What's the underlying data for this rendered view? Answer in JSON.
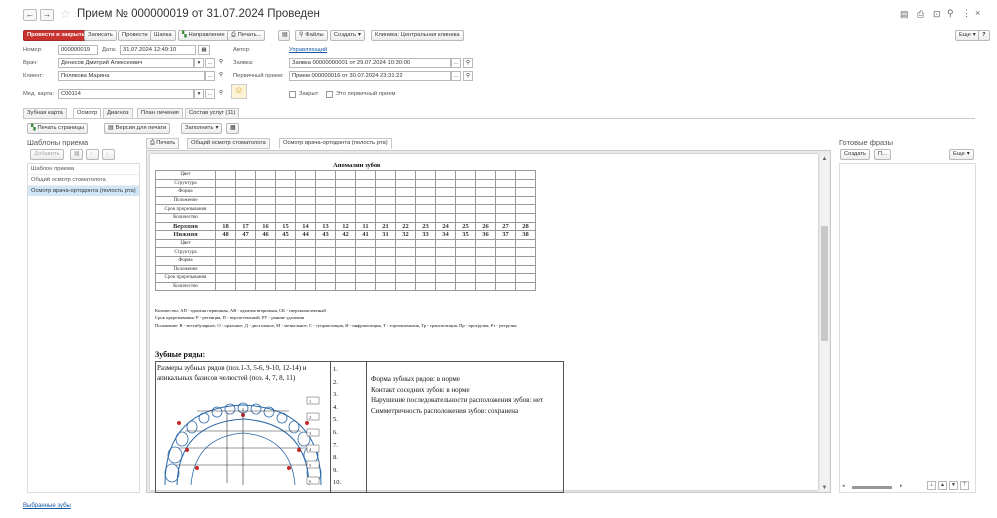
{
  "window": {
    "title": "Прием № 000000019 от 31.07.2024 Проведен",
    "more_button": "Еще",
    "help_button": "?"
  },
  "toolbar": {
    "post_close": "Провести и закрыть",
    "save": "Записать",
    "post": "Провести",
    "cap": "Шапка",
    "referral": "Направление",
    "print": "Печать...",
    "files": "Файлы",
    "create": "Создать",
    "clinic": "Клиника: Центральная клиника"
  },
  "header": {
    "number_label": "Номер:",
    "number_value": "000000019",
    "date_label": "Дата:",
    "date_value": "31.07.2024 12:49:10",
    "author_label": "Автор:",
    "author_value": "Управляющий",
    "doctor_label": "Врач:",
    "doctor_value": "Денисов Дмитрий Алексеевич",
    "order_label": "Заявка:",
    "order_value": "Заявка 00000000001 от 29.07.2024 10:30:00",
    "client_label": "Клиент:",
    "client_value": "Полякова Марина",
    "primary_label": "Первичный прием:",
    "primary_value": "Прием 000000016 от 30.07.2024 23:31:22",
    "card_label": "Мед. карта:",
    "card_value": "С00114",
    "closed_label": "Закрыт",
    "is_primary_label": "Это первичный прием"
  },
  "tabs": [
    "Зубная карта",
    "Осмотр",
    "Диагноз",
    "План лечения",
    "Состав услуг (11)"
  ],
  "exam_toolbar": {
    "print_pages": "Печать страницы",
    "print_version": "Версия для печати",
    "fill": "Заполнить"
  },
  "templates": {
    "title": "Шаблоны приема",
    "add": "Добавить",
    "items": [
      "Шаблон приема",
      "Общий осмотр стоматолога",
      "Осмотр врача-ортодонта (полость рта)"
    ]
  },
  "subtabs": [
    "Печать",
    "Общий осмотр стоматолога",
    "Осмотр врача-ортодонта (полость рта)"
  ],
  "ready_phrases": {
    "title": "Готовые фразы",
    "create": "Создать",
    "find": "П...",
    "more": "Еще"
  },
  "document": {
    "table_title": "Аномалии зубов",
    "row_labels_top": [
      "Цвет",
      "Структура",
      "Форма",
      "Положение",
      "Срок прорезывания",
      "Количество"
    ],
    "upper_label": "Верхняя",
    "upper_teeth": [
      "18",
      "17",
      "16",
      "15",
      "14",
      "13",
      "12",
      "11",
      "21",
      "22",
      "23",
      "24",
      "25",
      "26",
      "27",
      "28"
    ],
    "lower_label": "Нижняя",
    "lower_teeth": [
      "48",
      "47",
      "46",
      "45",
      "44",
      "43",
      "42",
      "41",
      "31",
      "32",
      "33",
      "34",
      "35",
      "36",
      "37",
      "38"
    ],
    "row_labels_bottom": [
      "Цвет",
      "Структура",
      "Форма",
      "Положение",
      "Срок прорезывания",
      "Количество"
    ],
    "legend1": "Количество: АП - адентия первичная, АВ - адентия вторичная, СК - сверхкомплектный",
    "legend2": "Срок прорезывания: Р - ретенция, П - персистентный, РУ - ранние удаления",
    "legend3": "Положение: В - вестибулярное, О - оральное, Д - дистальное, М - мезиальное, С - супрапозиция, И - инфрапозиция, Т - тортоаномалия, Тр - транспозиция, Пр - протрузия, Рт - ретрузия",
    "dental_rows_title": "Зубные ряды:",
    "dental_rows_desc": "Размеры зубных рядов (поз.1-3, 5-6, 9-10, 12-14) и апикальных базисов челюстей (поз. 4, 7, 8, 11)",
    "numbers": [
      "1.",
      "2.",
      "3.",
      "4.",
      "5.",
      "6.",
      "7.",
      "8.",
      "9.",
      "10."
    ],
    "diagram_labels": [
      "1",
      "2",
      "3",
      "4",
      "5",
      "6"
    ],
    "findings": [
      "Форма зубных рядов: в норме",
      "Контакт соседних зубов: в норме",
      "Нарушение последовательности расположения зубов: нет",
      "Симметричность расположения зубов: сохранена"
    ]
  },
  "footer": {
    "link": "Выбранные зубы"
  }
}
